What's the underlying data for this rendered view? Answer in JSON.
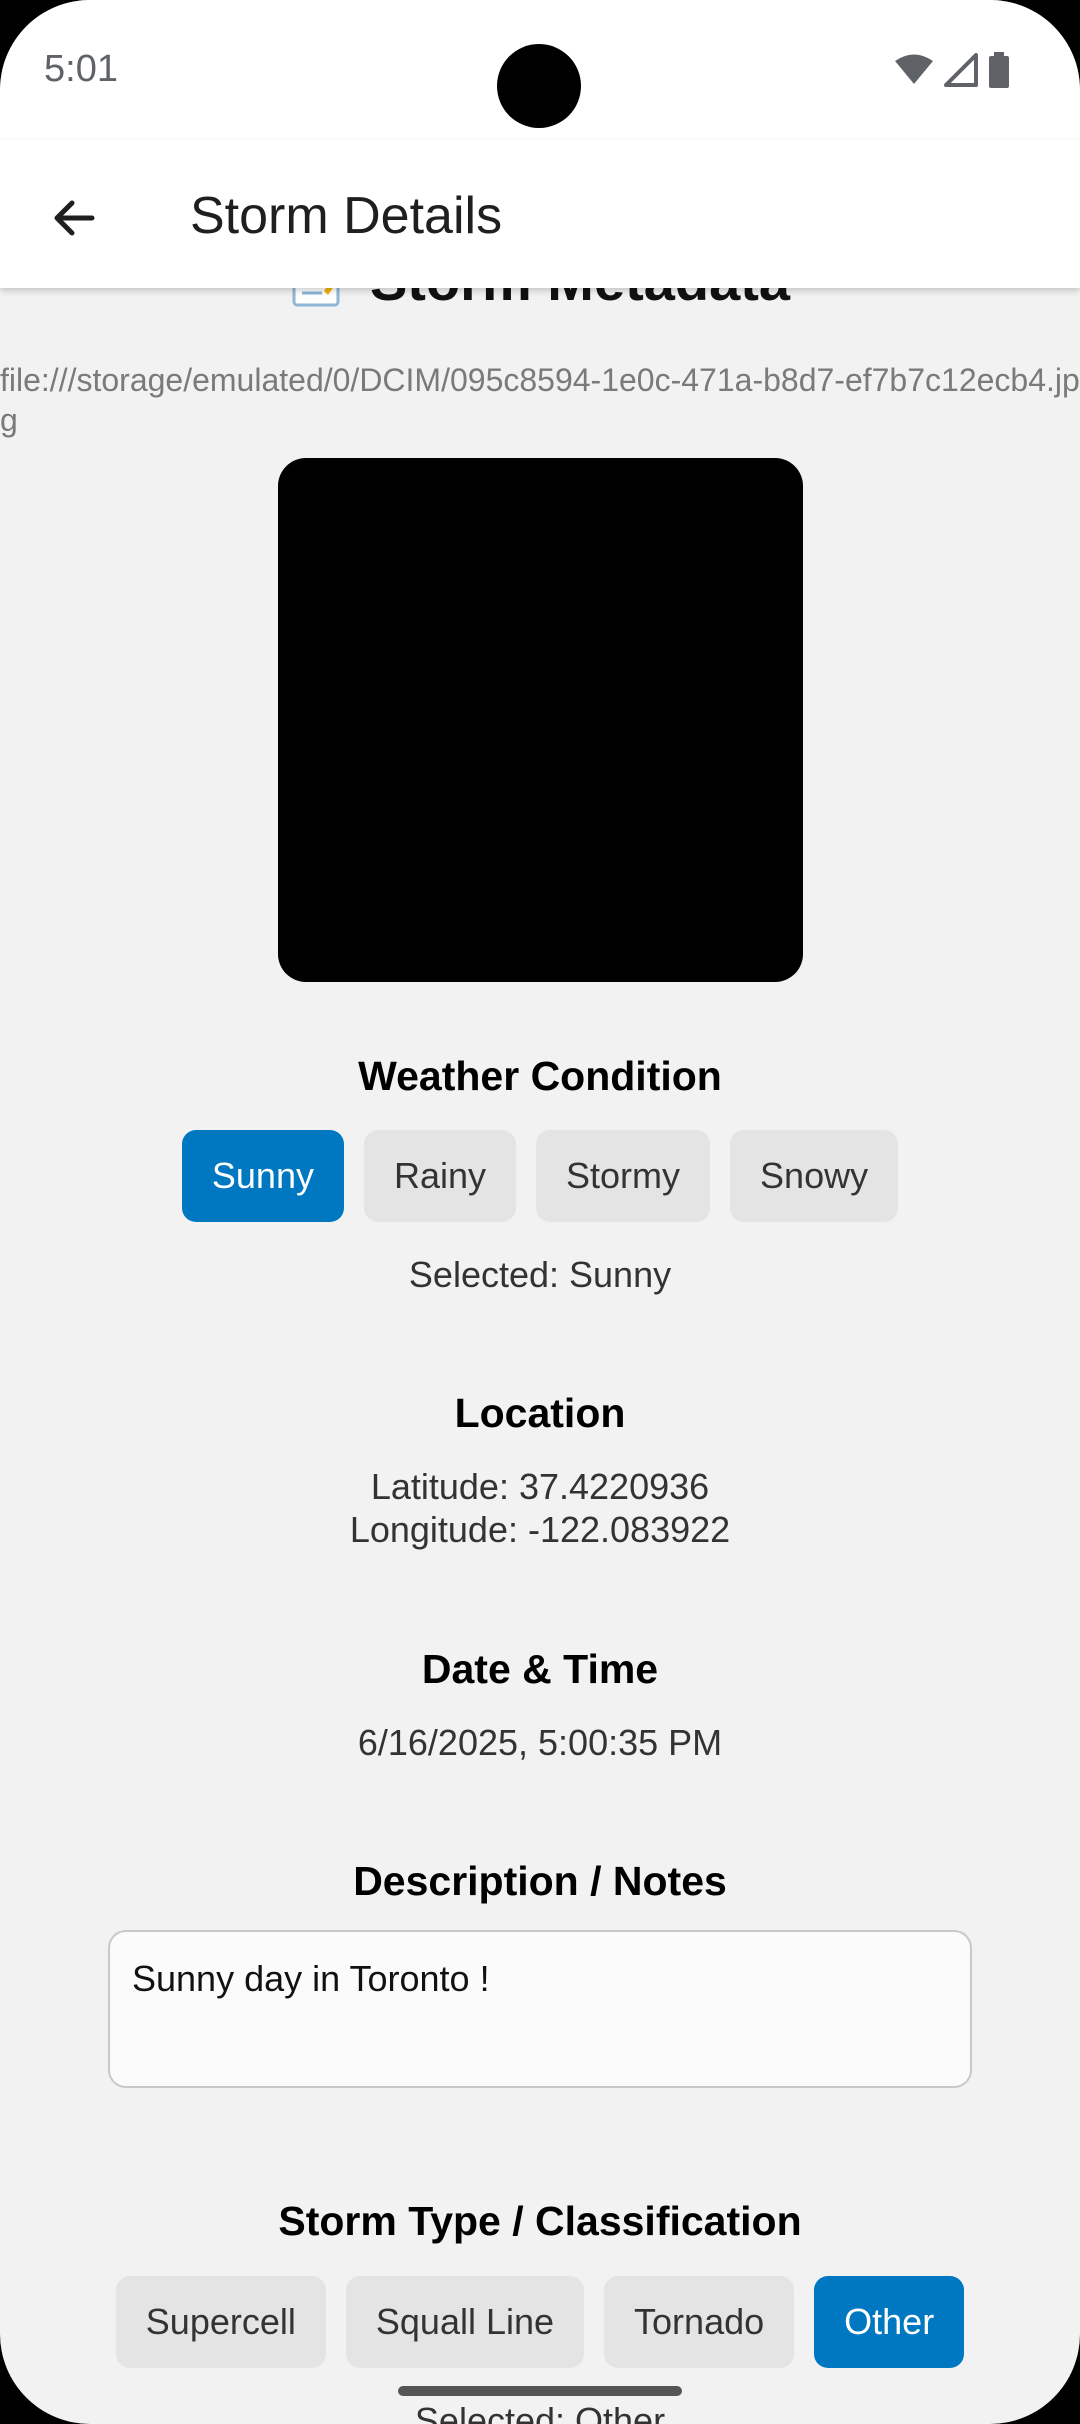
{
  "status_bar": {
    "time": "5:01"
  },
  "app_bar": {
    "title": "Storm Details"
  },
  "section": {
    "title": "Storm Metadata"
  },
  "photo": {
    "path": "file:///storage/emulated/0/DCIM/095c8594-1e0c-471a-b8d7-ef7b7c12ecb4.jpg"
  },
  "weather": {
    "heading": "Weather Condition",
    "options": [
      "Sunny",
      "Rainy",
      "Stormy",
      "Snowy"
    ],
    "selected_index": 0,
    "selected_text": "Selected: Sunny"
  },
  "location": {
    "heading": "Location",
    "latitude": "Latitude: 37.4220936",
    "longitude": "Longitude: -122.083922"
  },
  "datetime": {
    "heading": "Date & Time",
    "value": "6/16/2025, 5:00:35 PM"
  },
  "notes": {
    "heading": "Description / Notes",
    "value": "Sunny day in Toronto !"
  },
  "storm_type": {
    "heading": "Storm Type / Classification",
    "options": [
      "Supercell",
      "Squall Line",
      "Tornado",
      "Other"
    ],
    "selected_index": 3,
    "selected_text": "Selected: Other"
  },
  "colors": {
    "accent": "#0078c1",
    "chip": "#e4e4e4",
    "background": "#f2f2f2"
  }
}
